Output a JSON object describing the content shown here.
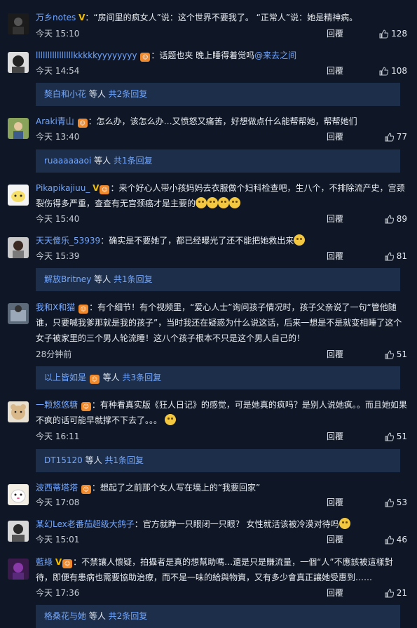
{
  "comments": [
    {
      "user": "万乡notes",
      "badge": "V",
      "text": "：“房间里的疯女人”说：这个世界不要我了。 “正常人”说：她是精神病。",
      "time": "今天 15:10",
      "reply": "回覆",
      "likes": "128"
    },
    {
      "user": "llllllllllllllllkkkkkyyyyyyyy",
      "badge": "Lv",
      "text": "：话题也夹 晚上睡得着觉吗",
      "mention": "@来去之间",
      "time": "今天 14:54",
      "reply": "回覆",
      "likes": "108"
    },
    {
      "user": "Araki青山",
      "badge": "Lv",
      "text": "：怎么办，该怎么办…又愤怒又痛苦，好想做点什么能帮帮她，帮帮她们",
      "time": "今天 13:40",
      "reply": "回覆",
      "likes": "77"
    },
    {
      "user": "Pikapikajiuu_",
      "badge": "V",
      "text": "：来个好心人带小孩妈妈去衣服做个妇科检查吧，生八个，不排除流产史，宫颈裂伤得多严重，查查有无宫颈癌才是主要的",
      "time": "今天 15:40",
      "reply": "回覆",
      "likes": "89"
    },
    {
      "user": "天天傻乐_53939",
      "text": "：确实是不要她了，都已经曝光了还不能把她救出来",
      "time": "今天 15:39",
      "reply": "回覆",
      "likes": "81"
    },
    {
      "user": "我和X和猫",
      "badge": "Lv",
      "text": "：有个细节！有个视频里，“爱心人士”询问孩子情况时，孩子父亲说了一句“管他随谁，只要喊我爹那就是我的孩子”，当时我还在疑惑为什么说这话，后来一想是不是就变相睡了这个女子被家里的三个男人轮流睡！这八个孩子根本不只是这个男人自己的！",
      "time": "28分钟前",
      "reply": "回覆",
      "likes": "51"
    },
    {
      "user": "一颗悠悠糖",
      "badge": "Lv",
      "text": "：有种看真实版《狂人日记》的感觉，可是她真的疯吗？是别人说她疯。。而且她如果不疯的话可能早就撑不下去了。。。",
      "time": "今天 16:11",
      "reply": "回覆",
      "likes": "51"
    },
    {
      "user": "波西蒂塔塔",
      "badge": "Lv",
      "text": "：想起了之前那个女人写在墙上的“我要回家”",
      "time": "今天 17:08",
      "reply": "回覆",
      "likes": "53"
    },
    {
      "user": "某幻Lex老番茄超级大鸽子",
      "text": "：官方就睁一只眼闭一只眼？ 女性就活该被冷漠对待吗",
      "time": "今天 15:01",
      "reply": "回覆",
      "likes": "46"
    },
    {
      "user": "藍綠",
      "badge": "V",
      "text": "：不禁讓人懷疑，拍攝者是真的想幫助嗎…還是只是賺流量，一個“人”不應該被這樣對待，即便有患病也需要協助治療，而不是一味的給與物資，又有多少會真正讓她受惠到……",
      "time": "今天 17:36",
      "reply": "回覆",
      "likes": "21"
    }
  ],
  "subs": [
    {
      "who": "獒白和小花",
      "mid": " 等人 ",
      "cnt": "共2条回复"
    },
    {
      "who": "ruaaaaaaoi",
      "mid": " 等人 ",
      "cnt": "共1条回复"
    },
    {
      "who": "解放Britney",
      "mid": " 等人 ",
      "cnt": "共1条回复"
    },
    {
      "who": "以上皆如是",
      "mid": " 等人 ",
      "cnt": "共3条回复"
    },
    {
      "who": "DT15120",
      "mid": " 等人 ",
      "cnt": "共1条回复"
    },
    {
      "who": "格桑花与她",
      "mid": " 等人 ",
      "cnt": "共2条回复"
    }
  ]
}
